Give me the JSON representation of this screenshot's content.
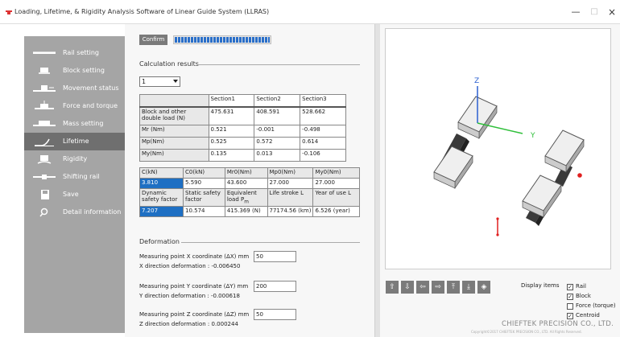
{
  "window": {
    "title": "Loading, Lifetime, & Rigidity Analysis Software of Linear Guide System (LLRAS)",
    "minimize": "—",
    "maximize": "□",
    "close": "×"
  },
  "sidebar": {
    "items": [
      {
        "label": "Rail setting",
        "icon": "rail-icon"
      },
      {
        "label": "Block setting",
        "icon": "block-icon"
      },
      {
        "label": "Movement status",
        "icon": "movement-icon"
      },
      {
        "label": "Force and torque",
        "icon": "force-icon"
      },
      {
        "label": "Mass setting",
        "icon": "mass-icon"
      },
      {
        "label": "Lifetime",
        "icon": "lifetime-icon",
        "active": true
      },
      {
        "label": "Rigidity",
        "icon": "rigidity-icon"
      },
      {
        "label": "Shifting rail",
        "icon": "shifting-rail-icon"
      },
      {
        "label": "Save",
        "icon": "save-icon"
      },
      {
        "label": "Detail information",
        "icon": "search-icon"
      }
    ]
  },
  "main": {
    "confirm_label": "Confirm",
    "progress": 1.0,
    "calc_title": "Calculation results",
    "section_select": "1",
    "results_table": {
      "headers": [
        "",
        "Section1",
        "Section2",
        "Section3"
      ],
      "rows": [
        {
          "label": "Block and other double load (N)",
          "values": [
            "475.631",
            "408.591",
            "528.662"
          ]
        },
        {
          "label": "Mr (Nm)",
          "values": [
            "0.521",
            "-0.001",
            "-0.498"
          ]
        },
        {
          "label": "Mp(Nm)",
          "values": [
            "0.525",
            "0.572",
            "0.614"
          ]
        },
        {
          "label": "My(Nm)",
          "values": [
            "0.135",
            "0.013",
            "-0.106"
          ]
        }
      ]
    },
    "capacity_table": {
      "headers": [
        "C(kN)",
        "C0(kN)",
        "Mr0(Nm)",
        "Mp0(Nm)",
        "My0(Nm)"
      ],
      "values": [
        "3.810",
        "5.590",
        "43.600",
        "27.000",
        "27.000"
      ],
      "headers2": [
        "Dynamic safety factor",
        "Static safety factor",
        "Equivalent load P",
        "Life stroke L",
        "Year of use L"
      ],
      "header2_sub": "m",
      "values2": [
        "7.207",
        "10.574",
        "415.369 (N)",
        "77174.56 (km)",
        "6.526 (year)"
      ]
    },
    "deformation": {
      "title": "Deformation",
      "x_label": "Measuring point X coordinate (ΔX) mm",
      "x_value": "50",
      "x_result": "X direction deformation : -0.006450",
      "y_label": "Measuring point Y coordinate (ΔY) mm",
      "y_value": "200",
      "y_result": "Y direction deformation : -0.000618",
      "z_label": "Measuring point Z coordinate (ΔZ) mm",
      "z_value": "50",
      "z_result": "Z direction deformation : 0.000244"
    }
  },
  "viewer": {
    "axis_z": "Z",
    "axis_y": "Y",
    "toolbar": [
      "⇧",
      "⇩",
      "⇦",
      "⇨",
      "⤒",
      "⤓",
      "◈"
    ],
    "display_items_title": "Display items",
    "display_items": [
      {
        "label": "Rail",
        "checked": true
      },
      {
        "label": "Block",
        "checked": true
      },
      {
        "label": "Force (torque)",
        "checked": false
      },
      {
        "label": "Centroid",
        "checked": true
      }
    ],
    "brand": "CHIEFTEK PRECISION CO., LTD.",
    "copyright": "Copyright©2017 CHIEFTEK PRECISION CO., LTD. All Rights Reserved."
  },
  "colors": {
    "sidebar_bg": "#a5a5a5",
    "sidebar_active": "#6f6f6f",
    "selected_cell": "#1e6fc3",
    "progress": "#2a6fc9",
    "axis_z": "#2a5fd0",
    "axis_y": "#2fbf3a",
    "centroid": "#e02020"
  }
}
